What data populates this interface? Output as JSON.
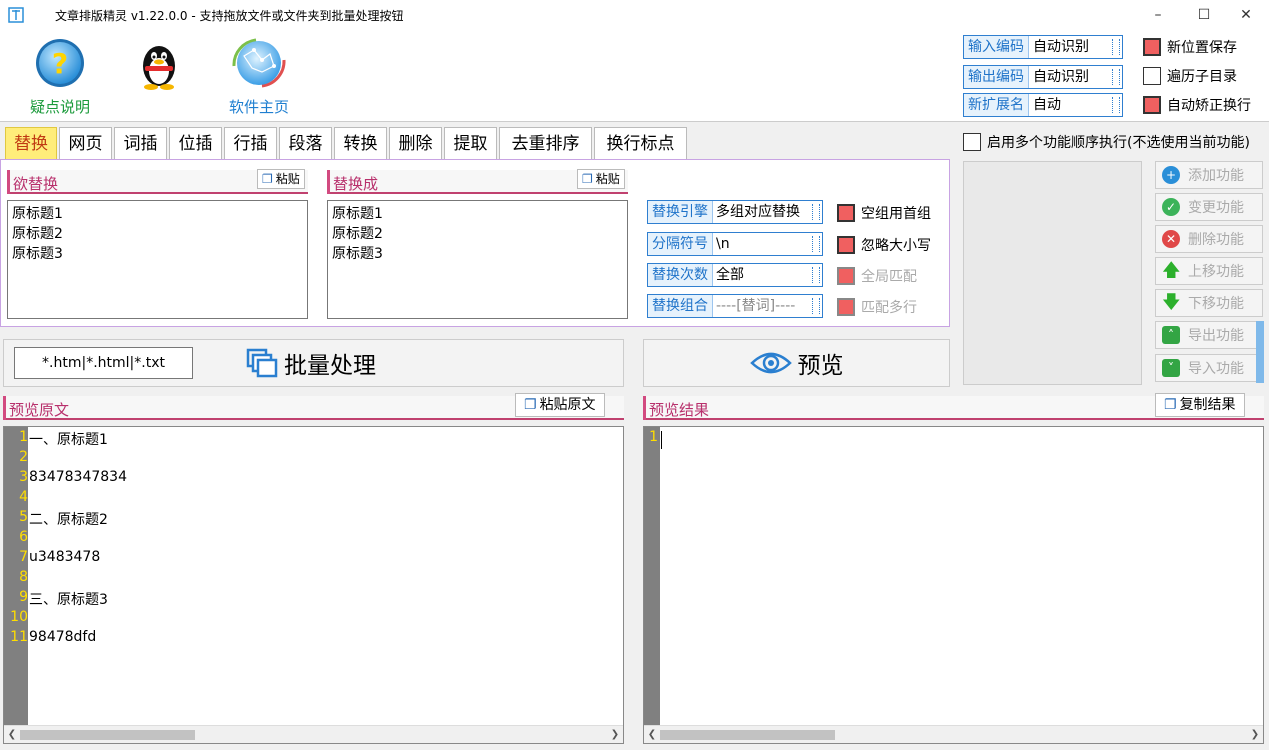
{
  "window": {
    "title": "文章排版精灵 v1.22.0.0 - 支持拖放文件或文件夹到批量处理按钮",
    "minimize_icon": "minimize-icon",
    "maximize_icon": "maximize-icon",
    "close_icon": "close-icon"
  },
  "toolbar": {
    "help_label": "疑点说明",
    "qq_icon": "qq-penguin-icon",
    "homepage_label": "软件主页"
  },
  "encoding": {
    "input_key": "输入编码",
    "input_value": "自动识别",
    "output_key": "输出编码",
    "output_value": "自动识别",
    "ext_key": "新扩展名",
    "ext_value": "自动"
  },
  "options": {
    "new_location_save": "新位置保存",
    "recurse_dirs": "遍历子目录",
    "auto_fix_newline": "自动矫正换行",
    "multi_function": "启用多个功能顺序执行(不选使用当前功能)"
  },
  "tabs": [
    "替换",
    "网页",
    "词插",
    "位插",
    "行插",
    "段落",
    "转换",
    "删除",
    "提取",
    "去重排序",
    "换行标点"
  ],
  "replace": {
    "find_header": "欲替换",
    "replace_header": "替换成",
    "paste_label": "粘贴",
    "find_lines": [
      "原标题1",
      "原标题2",
      "原标题3"
    ],
    "replace_lines": [
      "原标题1",
      "原标题2",
      "原标题3"
    ],
    "engine_key": "替换引擎",
    "engine_value": "多组对应替换",
    "sep_key": "分隔符号",
    "sep_value": "\\n",
    "count_key": "替换次数",
    "count_value": "全部",
    "combo_key": "替换组合",
    "combo_value": "----[替词]----",
    "empty_group_first": "空组用首组",
    "ignore_case": "忽略大小写",
    "global_match": "全局匹配",
    "match_multiline": "匹配多行"
  },
  "side_buttons": [
    "添加功能",
    "变更功能",
    "删除功能",
    "上移功能",
    "下移功能",
    "导出功能",
    "导入功能"
  ],
  "batch": {
    "filter": "*.htm|*.html|*.txt",
    "batch_label": "批量处理",
    "preview_label": "预览"
  },
  "preview": {
    "source_header": "预览原文",
    "paste_source": "粘贴原文",
    "result_header": "预览结果",
    "copy_result": "复制结果",
    "source_line_numbers": [
      "1",
      "2",
      "3",
      "4",
      "5",
      "6",
      "7",
      "8",
      "9",
      "10",
      "11"
    ],
    "source_lines": [
      "一、原标题1",
      "",
      "83478347834",
      "",
      "二、原标题2",
      "",
      "u3483478",
      "",
      "三、原标题3",
      "",
      "98478dfd"
    ],
    "result_line_numbers": [
      "1"
    ]
  },
  "colors": {
    "accent_blue": "#1f73c9",
    "checkbox_red": "#f06060",
    "tab_active_bg": "#ffed7a",
    "section_pink": "#b8306c",
    "gutter_gray": "#808080",
    "line_number_yellow": "#ffde00"
  }
}
